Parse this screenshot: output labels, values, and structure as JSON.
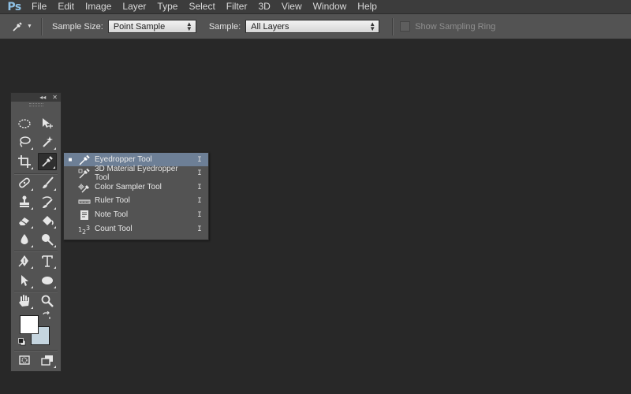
{
  "app": {
    "logo": "Ps",
    "menu": [
      "File",
      "Edit",
      "Image",
      "Layer",
      "Type",
      "Select",
      "Filter",
      "3D",
      "View",
      "Window",
      "Help"
    ]
  },
  "options_bar": {
    "sample_size_label": "Sample Size:",
    "sample_size_value": "Point Sample",
    "sample_label": "Sample:",
    "sample_value": "All Layers",
    "sampling_ring_label": "Show Sampling Ring",
    "sampling_ring_checked": false
  },
  "tools_panel": {
    "header_collapse": "◂◂",
    "header_close": "✕",
    "active_tool": "eyedropper",
    "foreground_color": "#ffffff",
    "background_color": "#c5d5df"
  },
  "flyout": {
    "items": [
      {
        "label": "Eyedropper Tool",
        "key": "I",
        "icon": "eyedropper-icon",
        "selected": true
      },
      {
        "label": "3D Material Eyedropper Tool",
        "key": "I",
        "icon": "3d-material-eyedropper-icon",
        "selected": false
      },
      {
        "label": "Color Sampler Tool",
        "key": "I",
        "icon": "color-sampler-icon",
        "selected": false
      },
      {
        "label": "Ruler Tool",
        "key": "I",
        "icon": "ruler-icon",
        "selected": false
      },
      {
        "label": "Note Tool",
        "key": "I",
        "icon": "note-icon",
        "selected": false
      },
      {
        "label": "Count Tool",
        "key": "I",
        "icon": "count-icon",
        "selected": false
      }
    ],
    "selected_bullet": "■"
  },
  "colors": {
    "accent_selected": "#6d7f96",
    "logo": "#8ec1e6",
    "canvas": "#282828"
  }
}
